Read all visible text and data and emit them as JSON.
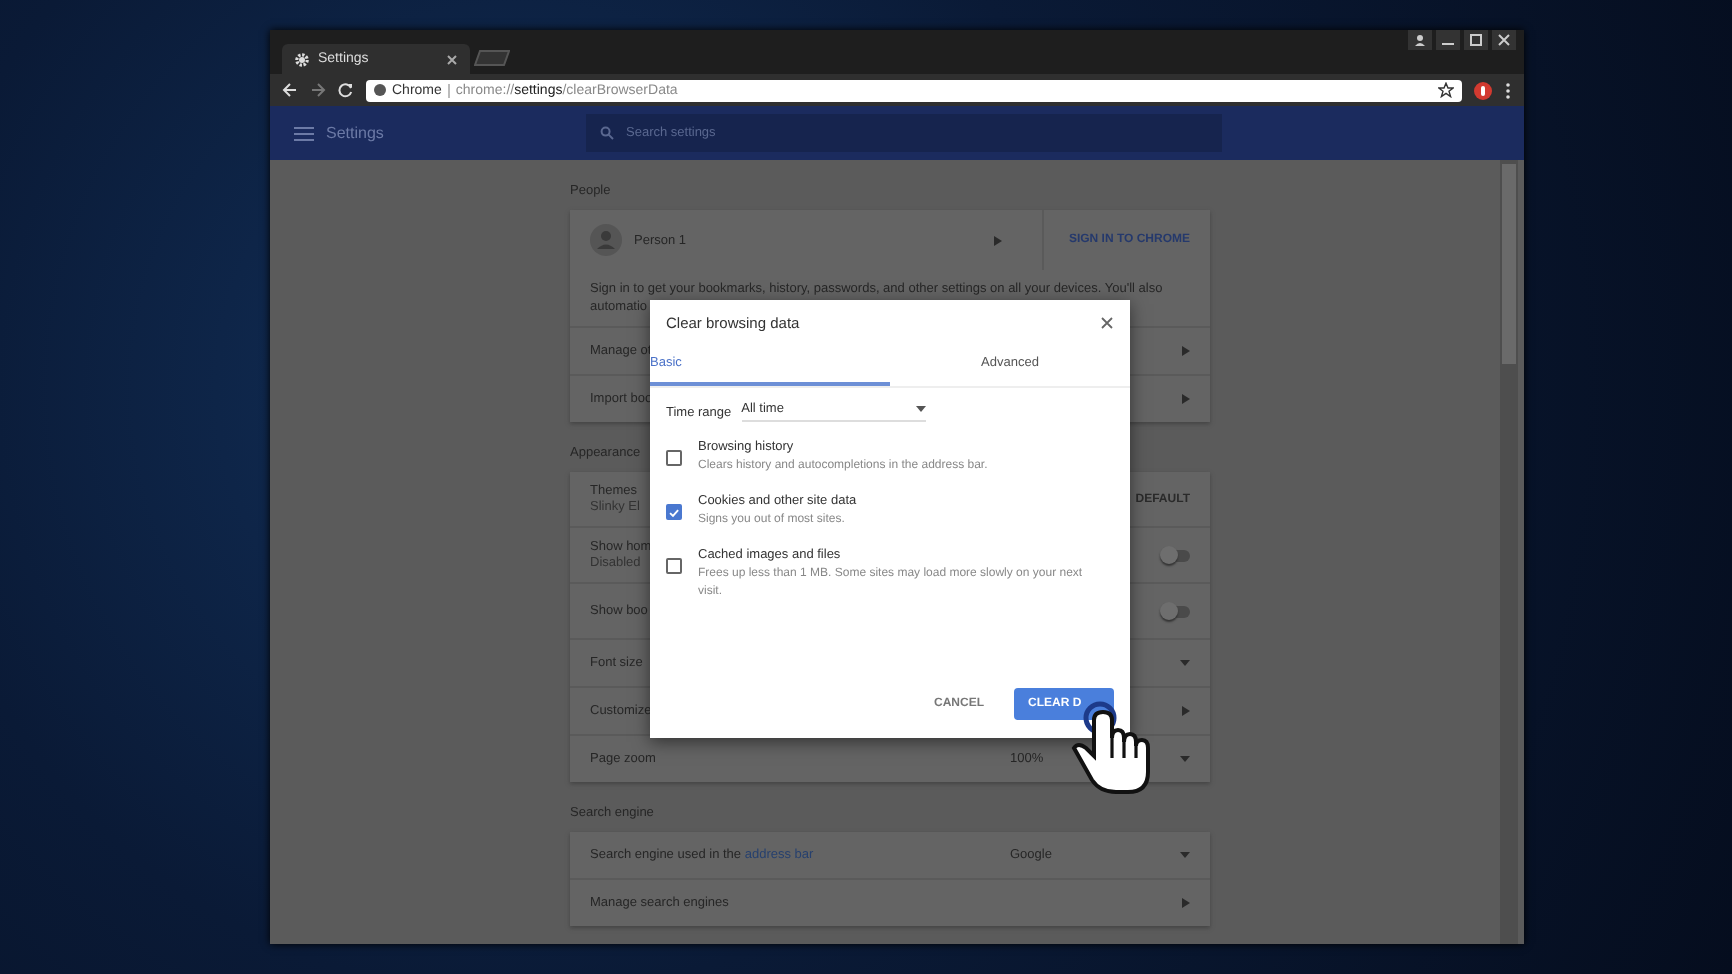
{
  "browser": {
    "tab": {
      "title": "Settings"
    },
    "omnibox": {
      "site_label": "Chrome",
      "url_scheme": "chrome://",
      "url_host": "settings",
      "url_path": "/clearBrowserData"
    }
  },
  "header": {
    "title": "Settings",
    "search_placeholder": "Search settings"
  },
  "sections": [
    {
      "heading": "People",
      "rows": [
        {
          "kind": "person",
          "label": "Person 1",
          "action": "SIGN IN TO CHROME"
        },
        {
          "kind": "text",
          "label": "Sign in to get your bookmarks, history, passwords, and other settings on all your devices. You'll also",
          "sublabel": "automatio"
        },
        {
          "kind": "link",
          "label": "Manage ot"
        },
        {
          "kind": "link",
          "label": "Import boo"
        }
      ]
    },
    {
      "heading": "Appearance",
      "rows": [
        {
          "kind": "theme",
          "label": "Themes",
          "sublabel": "Slinky El",
          "action": "DEFAULT"
        },
        {
          "kind": "toggle",
          "label": "Show hom",
          "sublabel": "Disabled",
          "on": false
        },
        {
          "kind": "toggle",
          "label": "Show boo",
          "on": false
        },
        {
          "kind": "select",
          "label": "Font size"
        },
        {
          "kind": "link",
          "label": "Customize"
        },
        {
          "kind": "select",
          "label": "Page zoom",
          "value": "100%"
        }
      ]
    },
    {
      "heading": "Search engine",
      "rows": [
        {
          "kind": "select",
          "label": "Search engine used in the ",
          "link": "address bar",
          "value": "Google"
        },
        {
          "kind": "link",
          "label": "Manage search engines"
        }
      ]
    }
  ],
  "dialog": {
    "title": "Clear browsing data",
    "tabs": [
      {
        "label": "Basic",
        "selected": true
      },
      {
        "label": "Advanced",
        "selected": false
      }
    ],
    "time_range": {
      "label": "Time range",
      "value": "All time"
    },
    "items": [
      {
        "title": "Browsing history",
        "description": "Clears history and autocompletions in the address bar.",
        "checked": false
      },
      {
        "title": "Cookies and other site data",
        "description": "Signs you out of most sites.",
        "checked": true
      },
      {
        "title": "Cached images and files",
        "description": "Frees up less than 1 MB. Some sites may load more slowly on your next visit.",
        "checked": false
      }
    ],
    "buttons": [
      {
        "label": "CANCEL",
        "kind": "text"
      },
      {
        "label": "CLEAR D",
        "kind": "primary"
      }
    ]
  }
}
